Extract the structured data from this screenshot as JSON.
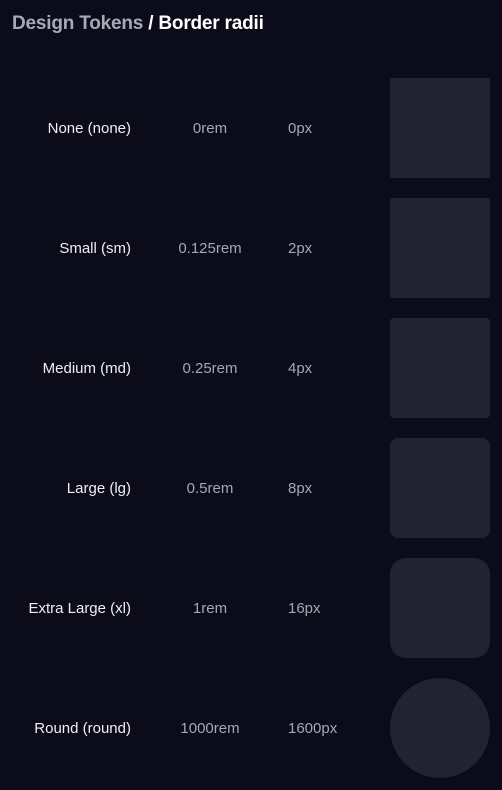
{
  "breadcrumb": {
    "parent": "Design Tokens",
    "separator": " / ",
    "current": "Border radii"
  },
  "colors": {
    "background": "#0b0b1a",
    "swatch": "#222230",
    "label": "#eeeef4",
    "muted": "#a6a6b4"
  },
  "radii": [
    {
      "name": "None (none)",
      "rem": "0rem",
      "px": "0px"
    },
    {
      "name": "Small (sm)",
      "rem": "0.125rem",
      "px": "2px"
    },
    {
      "name": "Medium (md)",
      "rem": "0.25rem",
      "px": "4px"
    },
    {
      "name": "Large (lg)",
      "rem": "0.5rem",
      "px": "8px"
    },
    {
      "name": "Extra Large (xl)",
      "rem": "1rem",
      "px": "16px"
    },
    {
      "name": "Round (round)",
      "rem": "1000rem",
      "px": "1600px"
    }
  ]
}
